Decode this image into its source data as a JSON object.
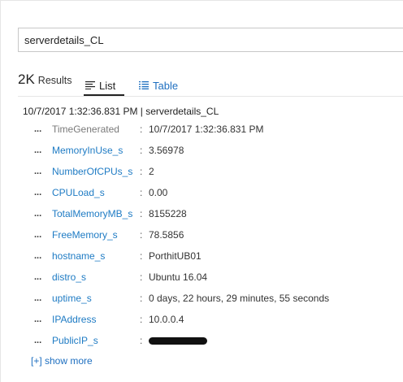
{
  "search": {
    "value": "serverdetails_CL"
  },
  "results": {
    "count": "2K",
    "label": "Results"
  },
  "tabs": {
    "list": "List",
    "table": "Table"
  },
  "record": {
    "header": "10/7/2017 1:32:36.831 PM | serverdetails_CL",
    "fields": [
      {
        "name": "TimeGenerated",
        "value": "10/7/2017 1:32:36.831 PM"
      },
      {
        "name": "MemoryInUse_s",
        "value": "3.56978"
      },
      {
        "name": "NumberOfCPUs_s",
        "value": "2"
      },
      {
        "name": "CPULoad_s",
        "value": "0.00"
      },
      {
        "name": "TotalMemoryMB_s",
        "value": "8155228"
      },
      {
        "name": "FreeMemory_s",
        "value": "78.5856"
      },
      {
        "name": "hostname_s",
        "value": "PorthitUB01"
      },
      {
        "name": "distro_s",
        "value": "Ubuntu 16.04"
      },
      {
        "name": "uptime_s",
        "value": "0 days, 22 hours, 29 minutes, 55 seconds"
      },
      {
        "name": "IPAddress",
        "value": "10.0.0.4"
      },
      {
        "name": "PublicIP_s",
        "value": ""
      }
    ],
    "ellipsis": "...",
    "colon": ":"
  },
  "show_more": "[+] show more",
  "colors": {
    "link": "#1e6fc0",
    "field_name": "#1e7bc4",
    "muted": "#7a7a7a"
  },
  "icons": {
    "list_tab": "list-lines-icon",
    "table_tab": "table-grid-icon"
  }
}
